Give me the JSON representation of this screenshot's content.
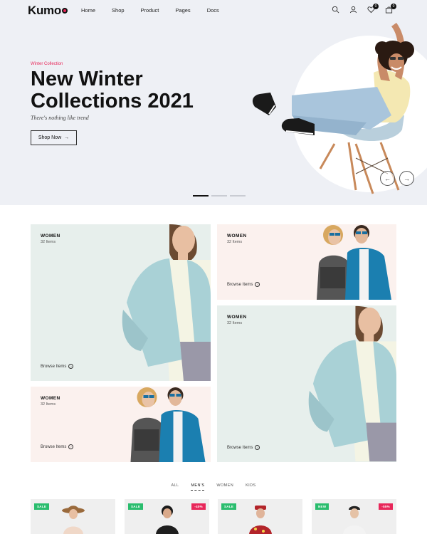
{
  "brand": {
    "name": "Kumo"
  },
  "nav": [
    "Home",
    "Shop",
    "Product",
    "Pages",
    "Docs"
  ],
  "header_icons": {
    "search": "search-icon",
    "account": "user-icon",
    "wishlist": {
      "icon": "heart-icon",
      "count": "0"
    },
    "cart": {
      "icon": "bag-icon",
      "count": "0"
    }
  },
  "hero": {
    "eyebrow": "Winter Collection",
    "title": "New Winter Collections 2021",
    "subtitle": "There's nothing like trend",
    "cta": "Shop Now",
    "prev": "←",
    "next": "→",
    "slides": 3,
    "active_slide": 0
  },
  "categories": [
    {
      "label": "WOMEN",
      "count": "32 Items",
      "browse": "Browse Items"
    },
    {
      "label": "WOMEN",
      "count": "32 Items",
      "browse": "Browse Items"
    },
    {
      "label": "WOMEN",
      "count": "32 Items",
      "browse": "Browse Items"
    },
    {
      "label": "WOMEN",
      "count": "32 Items",
      "browse": "Browse Items"
    }
  ],
  "tabs": [
    "ALL",
    "MEN'S",
    "WOMEN",
    "KIDS"
  ],
  "active_tab": "MEN'S",
  "products": [
    {
      "tag_left": "SALE",
      "tag_right": ""
    },
    {
      "tag_left": "SALE",
      "tag_right": "-40%"
    },
    {
      "tag_left": "SALE",
      "tag_right": ""
    },
    {
      "tag_left": "NEW",
      "tag_right": "-55%"
    }
  ],
  "colors": {
    "accent": "#e8275a",
    "sale": "#2bbd6e",
    "discount": "#e8275a",
    "hero_bg": "#eef0f5"
  }
}
